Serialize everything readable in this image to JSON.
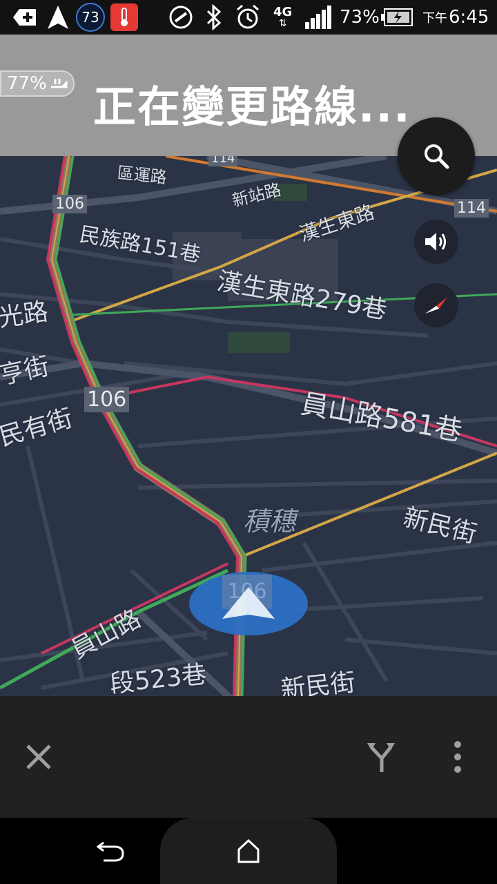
{
  "status_bar": {
    "notification_badge": "73",
    "battery_percent": "73%",
    "network": "4G",
    "time_prefix": "下午",
    "time": "6:45"
  },
  "header": {
    "title": "正在變更路線...",
    "battery_pill": "77%"
  },
  "map": {
    "labels": [
      {
        "text": "區運路"
      },
      {
        "text": "新站路"
      },
      {
        "text": "漢生東路"
      },
      {
        "text": "民族路151巷"
      },
      {
        "text": "漢生東路279巷"
      },
      {
        "text": "光路"
      },
      {
        "text": "亨街"
      },
      {
        "text": "民有街"
      },
      {
        "text": "員山路581巷"
      },
      {
        "text": "積穗"
      },
      {
        "text": "新民街"
      },
      {
        "text": "員山路"
      },
      {
        "text": "段523巷"
      },
      {
        "text": "新民街"
      }
    ],
    "shields": [
      "106",
      "106",
      "114",
      "114"
    ],
    "marker_shield": "106"
  },
  "colors": {
    "map_bg": "#2b3446",
    "road": "#4b5567",
    "route_yellow": "#d4a646",
    "route_red": "#c8365f",
    "route_green": "#3faa58",
    "route_orange": "#d27a2f",
    "marker_blue": "#2d6fc4"
  },
  "icons": {
    "search": "search-icon",
    "sound": "speaker-icon",
    "compass": "compass-icon",
    "close": "close-icon",
    "route_options": "fork-route-icon",
    "more": "more-vertical-icon",
    "back": "back-icon",
    "home": "home-icon"
  }
}
